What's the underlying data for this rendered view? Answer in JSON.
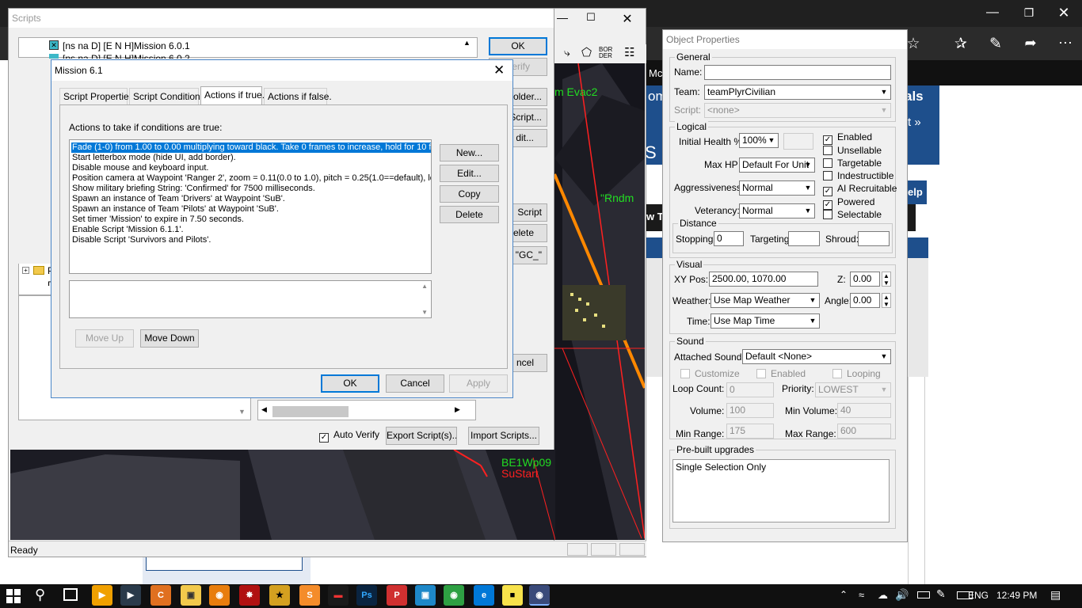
{
  "browser": {
    "partial_labels": [
      "Mc",
      "om",
      "als",
      "t »",
      "S",
      "elp",
      "w T"
    ]
  },
  "scripts_window": {
    "title": "Scripts",
    "tree_items": [
      {
        "label": "[ns na D] [E N H]Mission 6.0.1"
      },
      {
        "label": "[ns na D] [E N H]Mission 6.0.2"
      }
    ],
    "tree_partial_labels": [
      "P",
      "D"
    ],
    "right_buttons": [
      "OK",
      "Verify",
      "Folder...",
      "Script...",
      "dit...",
      "Script",
      "elete",
      "\"GC_\"",
      "ncel"
    ],
    "bottom": {
      "auto_verify_label": "Auto Verify",
      "export_label": "Export Script(s)...",
      "import_label": "Import Scripts..."
    },
    "status": "Ready"
  },
  "map_labels": {
    "evac": "m Evac2",
    "rndm": "\"Rndm",
    "wp": "BE1Wp09",
    "start": "SuStart",
    "toolbar_text": "BOR DER"
  },
  "dialog": {
    "title": "Mission 6.1",
    "tabs": [
      "Script Properties",
      "Script Conditions",
      "Actions if true.",
      "Actions if false."
    ],
    "section_label": "Actions to take if conditions are true:",
    "actions": [
      "Fade (1-0) from 1.00 to 0.00 multiplying toward black. Take  0  frames to increase, hold for  10  fa",
      "Start letterbox mode (hide UI, add border).",
      "Disable mouse and keyboard input.",
      "Position camera at Waypoint 'Ranger 2', zoom = 0.11(0.0 to 1.0), pitch = 0.25(1.0==default), look",
      "Show military briefing String: 'Confirmed' for  7500  milliseconds.",
      "Spawn an instance of Team 'Drivers' at Waypoint 'SuB'.",
      "Spawn an instance of Team 'Pilots' at Waypoint 'SuB'.",
      "Set timer 'Mission' to expire in 7.50 seconds.",
      "Enable Script 'Mission 6.1.1'.",
      "Disable Script 'Survivors and Pilots'."
    ],
    "side_buttons": [
      "New...",
      "Edit...",
      "Copy",
      "Delete"
    ],
    "move_up": "Move Up",
    "move_down": "Move Down",
    "ok": "OK",
    "cancel": "Cancel",
    "apply": "Apply"
  },
  "object_properties": {
    "title": "Object Properties",
    "general": {
      "title": "General",
      "name_label": "Name:",
      "name_value": "",
      "team_label": "Team:",
      "team_value": "teamPlyrCivilian",
      "script_label": "Script:",
      "script_value": "<none>"
    },
    "logical": {
      "title": "Logical",
      "health_label": "Initial Health %",
      "health_value": "100%",
      "maxhp_label": "Max HP",
      "maxhp_value": "Default For Unit",
      "aggr_label": "Aggressiveness:",
      "aggr_value": "Normal",
      "vet_label": "Veterancy:",
      "vet_value": "Normal",
      "checks": [
        {
          "label": "Enabled",
          "checked": true
        },
        {
          "label": "Unsellable",
          "checked": false
        },
        {
          "label": "Targetable",
          "checked": false
        },
        {
          "label": "Indestructible",
          "checked": false
        },
        {
          "label": "AI Recruitable",
          "checked": true
        },
        {
          "label": "Powered",
          "checked": true
        },
        {
          "label": "Selectable",
          "checked": false
        }
      ],
      "distance": {
        "title": "Distance",
        "stopping_label": "Stopping:",
        "stopping_value": "0",
        "targeting_label": "Targeting:",
        "targeting_value": "",
        "shroud_label": "Shroud:",
        "shroud_value": ""
      }
    },
    "visual": {
      "title": "Visual",
      "xy_label": "XY Pos:",
      "xy_value": "2500.00, 1070.00",
      "z_label": "Z:",
      "z_value": "0.00",
      "weather_label": "Weather:",
      "weather_value": "Use Map Weather",
      "angle_label": "Angle:",
      "angle_value": "0.00",
      "time_label": "Time:",
      "time_value": "Use Map Time"
    },
    "sound": {
      "title": "Sound",
      "attached_label": "Attached Sound:",
      "attached_value": "Default <None>",
      "customize": "Customize",
      "enabled": "Enabled",
      "looping": "Looping",
      "loop_count_label": "Loop Count:",
      "loop_count_value": "0",
      "priority_label": "Priority:",
      "priority_value": "LOWEST",
      "volume_label": "Volume:",
      "volume_value": "100",
      "min_volume_label": "Min Volume:",
      "min_volume_value": "40",
      "min_range_label": "Min Range:",
      "min_range_value": "175",
      "max_range_label": "Max Range:",
      "max_range_value": "600"
    },
    "upgrades": {
      "title": "Pre-built upgrades",
      "items": [
        "Single Selection Only"
      ]
    }
  },
  "taskbar": {
    "language": "ENG",
    "time": "12:49 PM"
  },
  "colors": {
    "accent": "#0078d7",
    "selection": "#0078d7",
    "edge_nav": "#1e4f8c",
    "map_green": "#22dd22",
    "map_red": "#ff2020",
    "map_orange": "#ff8800"
  }
}
